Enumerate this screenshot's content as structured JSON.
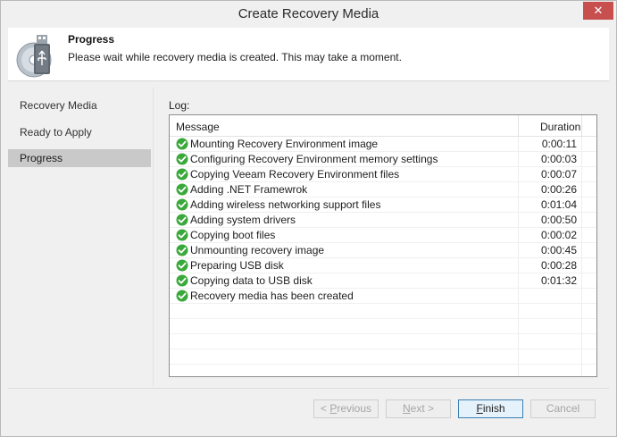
{
  "window": {
    "title": "Create Recovery Media",
    "close_glyph": "✕"
  },
  "header": {
    "title": "Progress",
    "subtitle": "Please wait while recovery media is created. This may take a moment.",
    "icon": "usb-disc-icon"
  },
  "sidebar": {
    "items": [
      {
        "label": "Recovery Media",
        "active": false
      },
      {
        "label": "Ready to Apply",
        "active": false
      },
      {
        "label": "Progress",
        "active": true
      }
    ]
  },
  "log": {
    "label": "Log:",
    "columns": {
      "message": "Message",
      "duration": "Duration"
    },
    "rows": [
      {
        "message": "Mounting Recovery Environment image",
        "duration": "0:00:11",
        "status": "success"
      },
      {
        "message": "Configuring Recovery Environment memory settings",
        "duration": "0:00:03",
        "status": "success"
      },
      {
        "message": "Copying Veeam Recovery Environment files",
        "duration": "0:00:07",
        "status": "success"
      },
      {
        "message": "Adding .NET Framewrok",
        "duration": "0:00:26",
        "status": "success"
      },
      {
        "message": "Adding wireless networking support files",
        "duration": "0:01:04",
        "status": "success"
      },
      {
        "message": "Adding system drivers",
        "duration": "0:00:50",
        "status": "success"
      },
      {
        "message": "Copying boot files",
        "duration": "0:00:02",
        "status": "success"
      },
      {
        "message": "Unmounting recovery image",
        "duration": "0:00:45",
        "status": "success"
      },
      {
        "message": "Preparing USB disk",
        "duration": "0:00:28",
        "status": "success"
      },
      {
        "message": "Copying data to USB disk",
        "duration": "0:01:32",
        "status": "success"
      },
      {
        "message": "Recovery media has been created",
        "duration": "",
        "status": "success"
      }
    ]
  },
  "footer": {
    "previous": {
      "mnemonic": "P",
      "rest": "revious",
      "prefix": "< ",
      "enabled": false
    },
    "next": {
      "mnemonic": "N",
      "rest": "ext",
      "suffix": " >",
      "enabled": false
    },
    "finish": {
      "mnemonic": "F",
      "rest": "inish",
      "enabled": true
    },
    "cancel": {
      "label": "Cancel",
      "enabled": false
    }
  },
  "colors": {
    "success": "#3aa83a",
    "close": "#c7504f",
    "selected": "#c9c9c9"
  }
}
